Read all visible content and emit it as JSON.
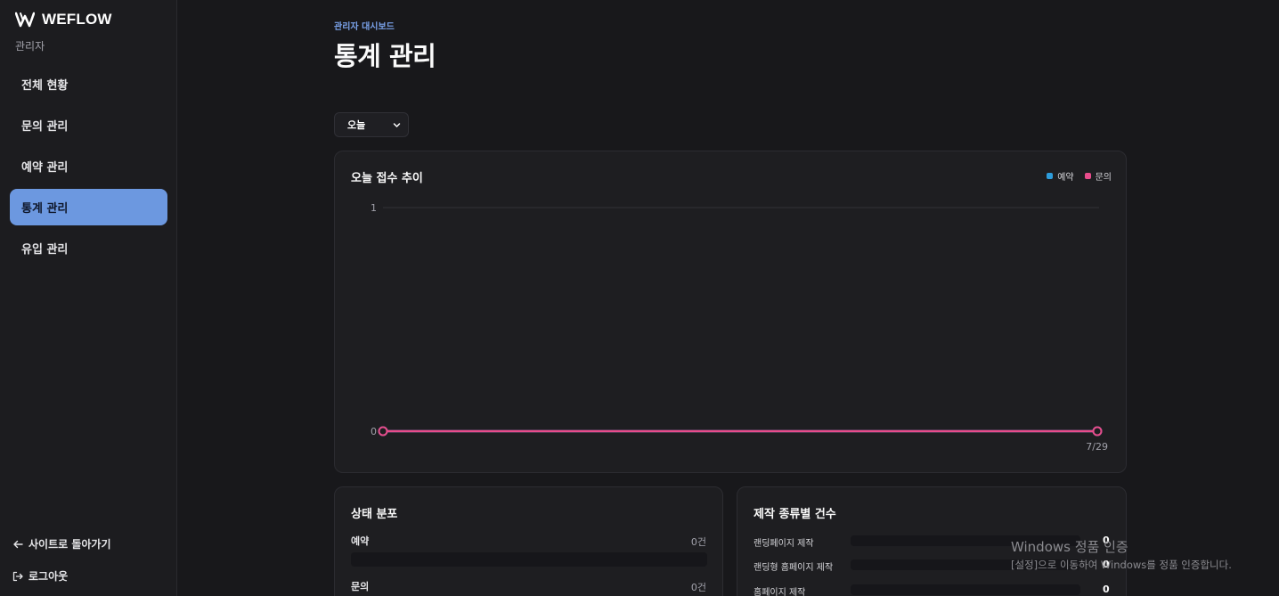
{
  "sidebar": {
    "brand": "WEFLOW",
    "role": "관리자",
    "items": [
      {
        "label": "전체 현황",
        "active": false
      },
      {
        "label": "문의 관리",
        "active": false
      },
      {
        "label": "예약 관리",
        "active": false
      },
      {
        "label": "통계 관리",
        "active": true
      },
      {
        "label": "유입 관리",
        "active": false
      }
    ],
    "back_link": "사이트로 돌아가기",
    "logout": "로그아웃"
  },
  "header": {
    "breadcrumb": "관리자 대시보드",
    "title": "통계 관리"
  },
  "filter": {
    "selected": "오늘"
  },
  "trend_card": {
    "title": "오늘 접수 추이",
    "legend": [
      {
        "label": "예약",
        "color": "#2d9cdb"
      },
      {
        "label": "문의",
        "color": "#e84c8b"
      }
    ]
  },
  "chart_data": {
    "type": "line",
    "x": [
      "",
      "7/29"
    ],
    "series": [
      {
        "name": "예약",
        "values": [
          0,
          0
        ],
        "color": "#2d9cdb"
      },
      {
        "name": "문의",
        "values": [
          0,
          0
        ],
        "color": "#e84c8b"
      }
    ],
    "ylim": [
      0,
      1
    ],
    "yticks": [
      "1",
      "0"
    ],
    "grid": true,
    "legend_position": "top-right"
  },
  "status_card": {
    "title": "상태 분포",
    "rows": [
      {
        "label": "예약",
        "value": "0건"
      },
      {
        "label": "문의",
        "value": "0건"
      }
    ]
  },
  "kind_card": {
    "title": "제작 종류별 건수",
    "rows": [
      {
        "label": "랜딩페이지 제작",
        "value": "0"
      },
      {
        "label": "랜딩형 홈페이지 제작",
        "value": "0"
      },
      {
        "label": "홈페이지 제작",
        "value": "0"
      }
    ]
  },
  "watermark": {
    "title": "Windows 정품 인증",
    "subtitle": "[설정]으로 이동하여 Windows를 정품 인증합니다."
  }
}
